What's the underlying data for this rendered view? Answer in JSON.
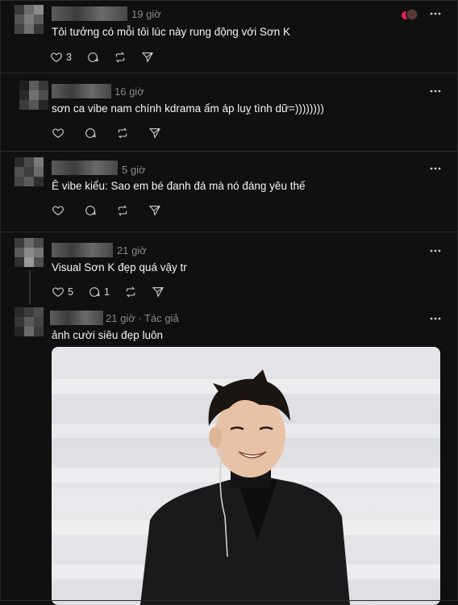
{
  "posts": [
    {
      "time": "19 giờ",
      "text": "Tôi tưởng có mỗi tôi lúc này rung động với Sơn K",
      "likes": "3",
      "replies": ""
    },
    {
      "time": "16 giờ",
      "text": "sơn ca vibe nam chính kdrama ấm áp luỵ tình dữ=))))))))",
      "likes": "",
      "replies": ""
    },
    {
      "time": "5 giờ",
      "text": "Ê vibe kiểu: Sao em bé đanh đá mà nó đáng yêu thế",
      "likes": "",
      "replies": ""
    },
    {
      "time": "21 giờ",
      "text": "Visual Sơn K đẹp quá vậy tr",
      "likes": "5",
      "replies": "1"
    },
    {
      "time": "21 giờ",
      "author_tag": "· Tác giả",
      "text": "ảnh cười siêu đẹp luôn",
      "likes": "",
      "replies": ""
    }
  ],
  "icons": {
    "like": "heart-icon",
    "reply": "comment-icon",
    "repost": "repost-icon",
    "share": "send-icon",
    "more": "more-icon"
  }
}
